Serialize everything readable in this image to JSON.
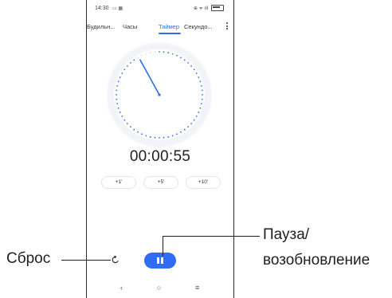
{
  "statusbar": {
    "time": "14:30",
    "left_icons": "▭ ▦",
    "right_icons": "⊕ ᯤ ıll"
  },
  "tabs": [
    {
      "label": "Будильн...",
      "active": false
    },
    {
      "label": "Часы",
      "active": false
    },
    {
      "label": "Таймер",
      "active": true
    },
    {
      "label": "Секундо...",
      "active": false
    }
  ],
  "more_icon": "more-vertical-icon",
  "timer": {
    "display": "00:00:55",
    "remaining_fraction": 0.92
  },
  "quick_add": [
    {
      "label": "+1'"
    },
    {
      "label": "+5'"
    },
    {
      "label": "+10'"
    }
  ],
  "controls": {
    "reset_icon": "reset-icon",
    "pause_icon": "pause-icon"
  },
  "nav": {
    "back": "‹",
    "home": "○",
    "recents": "≡"
  },
  "callouts": {
    "reset": "Сброс",
    "pause_line1": "Пауза/",
    "pause_line2": "возобновление"
  },
  "colors": {
    "accent": "#2f6df6",
    "dial_bg": "#f2f4f8",
    "text": "#1f1f1f"
  }
}
